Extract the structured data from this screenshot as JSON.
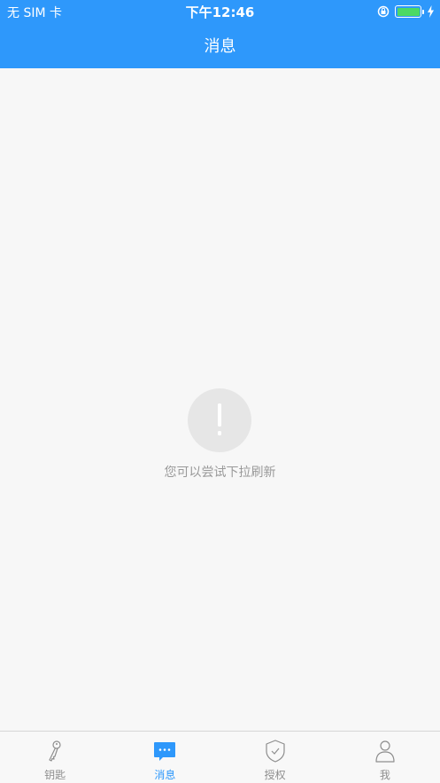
{
  "status_bar": {
    "carrier": "无 SIM 卡",
    "time": "下午12:46",
    "battery_percent": 100
  },
  "header": {
    "title": "消息"
  },
  "empty_state": {
    "icon_glyph": "!",
    "message": "您可以尝试下拉刷新"
  },
  "tabbar": {
    "tabs": [
      {
        "label": "钥匙",
        "icon": "key-icon",
        "active": false
      },
      {
        "label": "消息",
        "icon": "message-icon",
        "active": true
      },
      {
        "label": "授权",
        "icon": "shield-check-icon",
        "active": false
      },
      {
        "label": "我",
        "icon": "person-icon",
        "active": false
      }
    ]
  },
  "colors": {
    "accent": "#2e98fb",
    "battery": "#4cd964",
    "inactive_tab": "#8e8e8e",
    "empty_text": "#999999"
  }
}
